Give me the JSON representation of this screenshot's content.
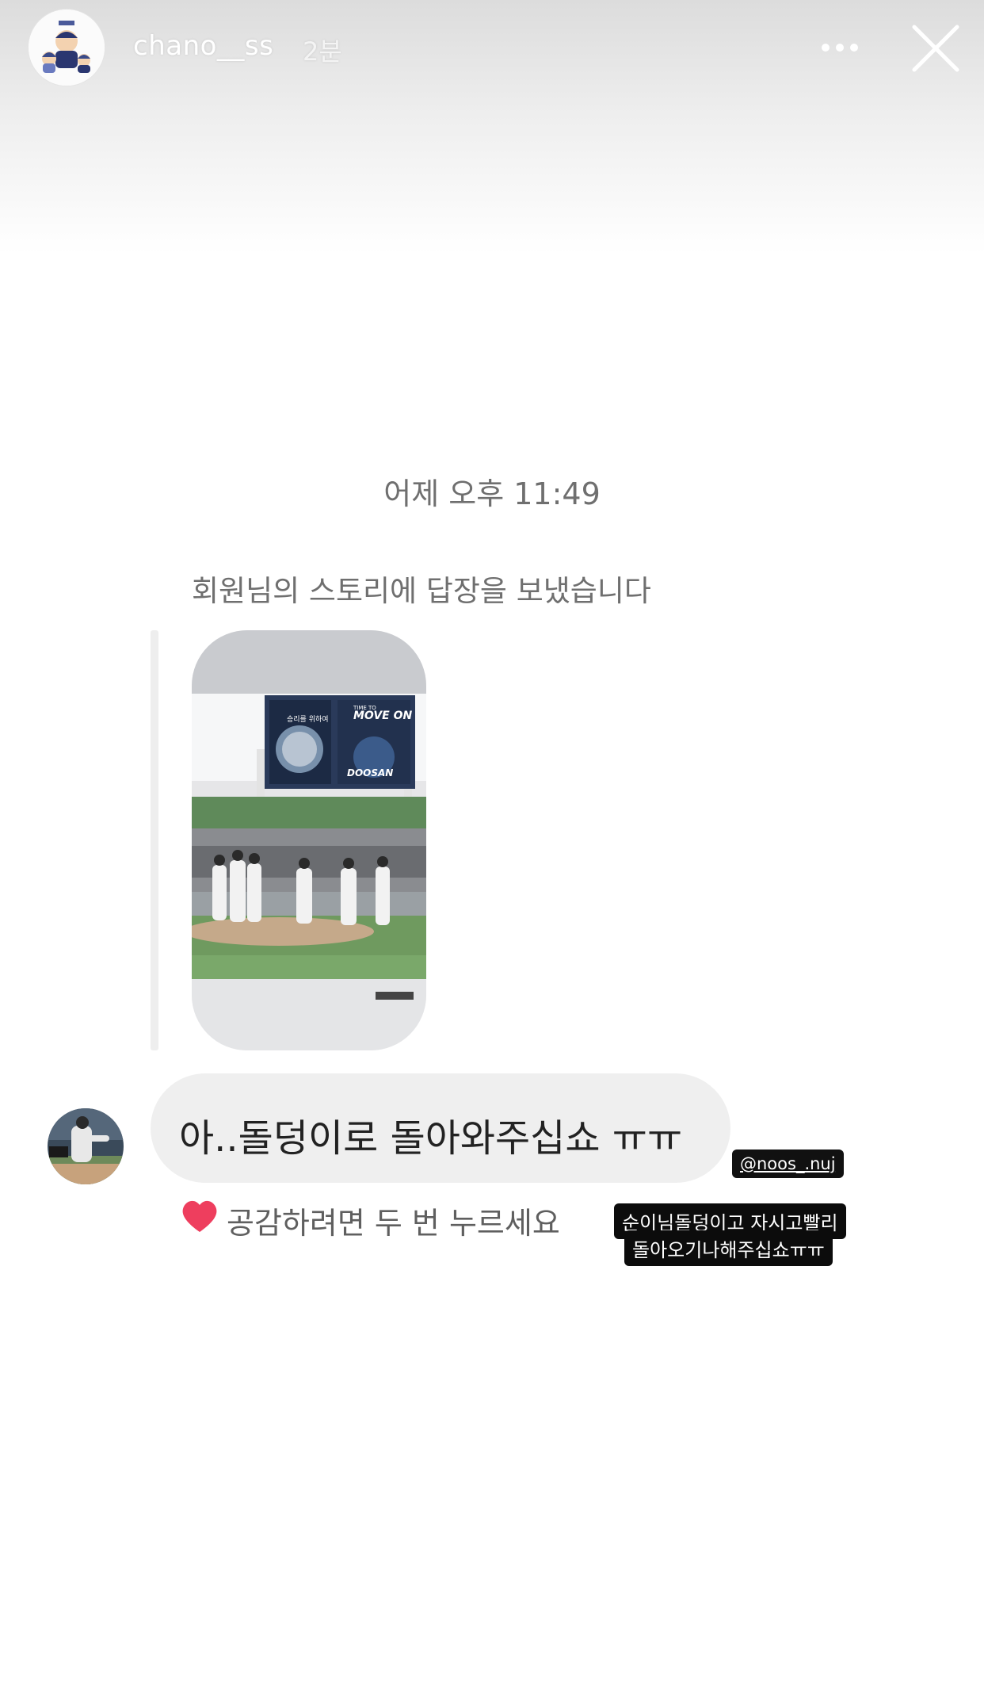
{
  "header": {
    "username": "chano__ss",
    "time_ago": "2분",
    "more_icon": "more-dots-icon",
    "close_icon": "close-icon"
  },
  "dm": {
    "timestamp": "어제 오후 11:49",
    "reply_note": "회원님의 스토리에 답장을 보냈습니다",
    "story_preview": {
      "scoreboard_left": "승리를 위하여",
      "scoreboard_title": "MOVE ON",
      "scoreboard_small": "TIME TO",
      "scoreboard_brand": "DOOSAN"
    },
    "message": "아..돌덩이로 돌아와주십쇼 ㅠㅠ",
    "like_hint": "공감하려면 두 번 누르세요",
    "heart_icon": "heart-icon"
  },
  "stickers": {
    "mention": "@noos_.nuj",
    "caption_line_1": "순이님돌덩이고 자시고빨리",
    "caption_line_2": "돌아오기나해주십쇼ㅠㅠ"
  },
  "colors": {
    "bubble": "#efefef",
    "text_gray": "#6f6f6f",
    "heart": "#ee3e5e"
  }
}
